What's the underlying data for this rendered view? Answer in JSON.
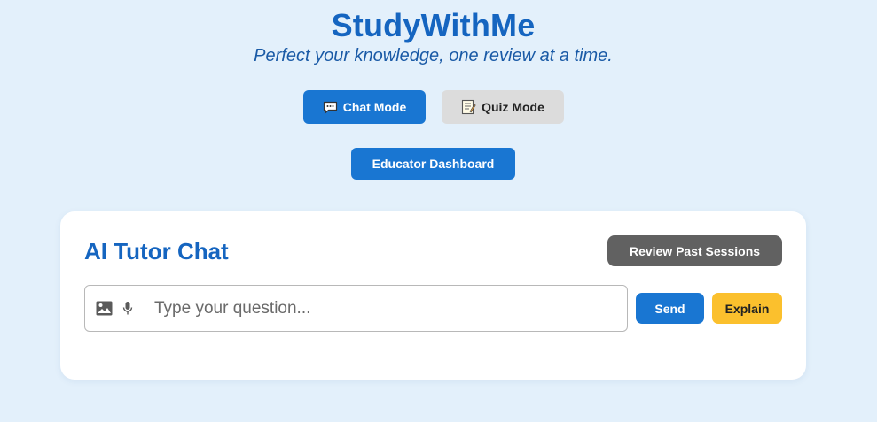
{
  "header": {
    "title": "StudyWithMe",
    "tagline": "Perfect your knowledge, one review at a time."
  },
  "modes": {
    "chat_label": "Chat Mode",
    "chat_icon": "speech-balloon-icon",
    "quiz_label": "Quiz Mode",
    "quiz_icon": "memo-icon"
  },
  "educator_dashboard_label": "Educator Dashboard",
  "chat": {
    "title": "AI Tutor Chat",
    "review_label": "Review Past Sessions",
    "input": {
      "value": "",
      "placeholder": "Type your question...",
      "image_icon": "image-icon",
      "mic_icon": "microphone-icon"
    },
    "send_label": "Send",
    "explain_label": "Explain"
  },
  "colors": {
    "background": "#e3f0fb",
    "primary": "#1976d2",
    "title": "#1565c0",
    "secondary_button": "#dcdcdc",
    "review_button": "#616161",
    "explain_button": "#fbc02d"
  }
}
